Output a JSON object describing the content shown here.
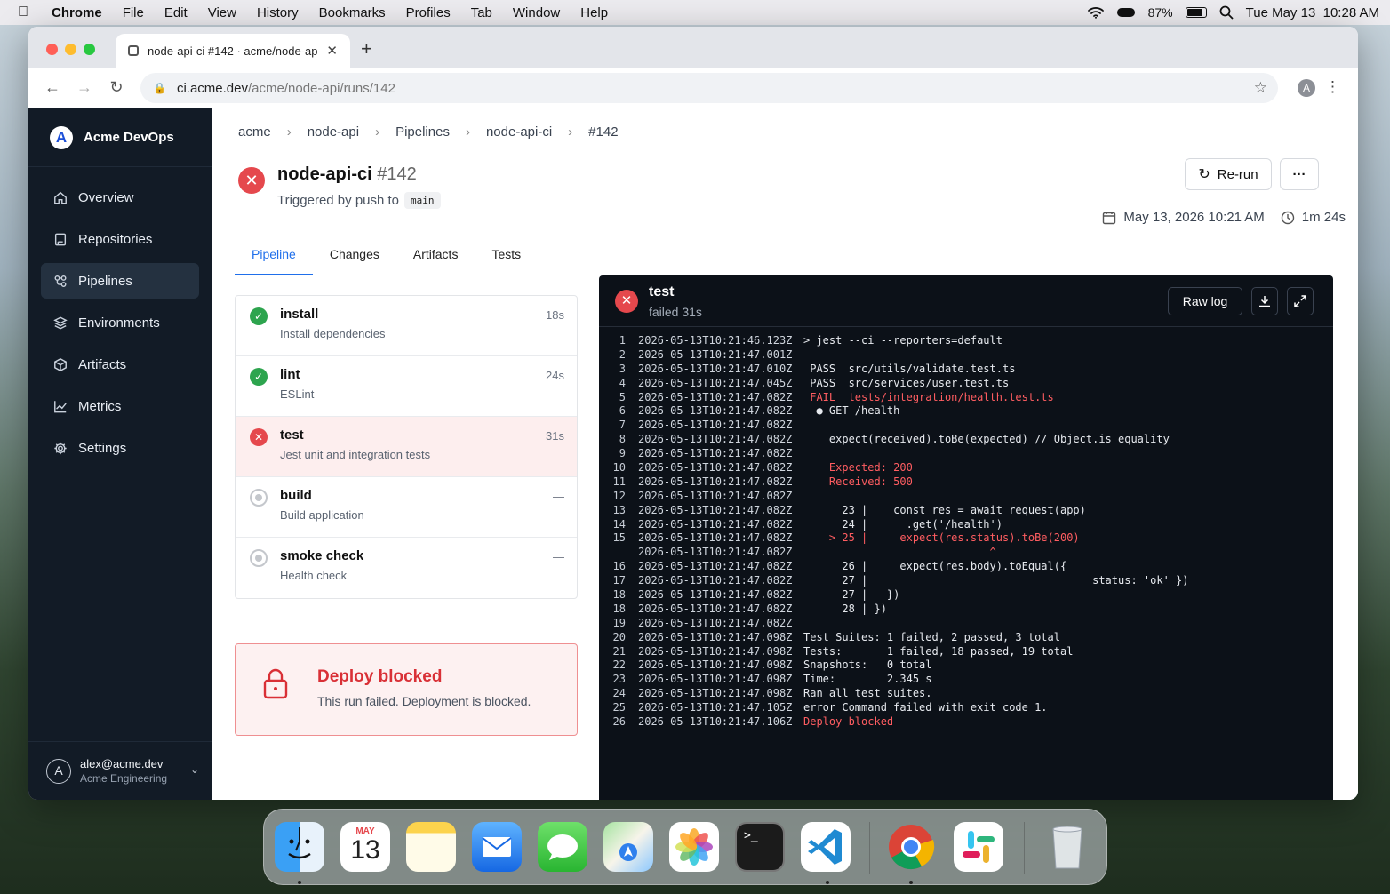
{
  "menubar": {
    "app": "Chrome",
    "items": [
      "File",
      "Edit",
      "View",
      "History",
      "Bookmarks",
      "Profiles",
      "Tab",
      "Window",
      "Help"
    ],
    "battery": "87%",
    "datetime": "Tue May 13  10:28 AM"
  },
  "browser": {
    "tab_title": "node-api-ci #142 · acme/node-ap",
    "url_host": "ci.acme.dev",
    "url_path": "/acme/node-api/runs/142",
    "profile_initial": "A"
  },
  "sidebar": {
    "brand": "Acme DevOps",
    "brand_initial": "A",
    "items": [
      {
        "label": "Overview",
        "icon": "home-icon"
      },
      {
        "label": "Repositories",
        "icon": "book-icon"
      },
      {
        "label": "Pipelines",
        "icon": "pipeline-icon",
        "active": true
      },
      {
        "label": "Environments",
        "icon": "layers-icon"
      },
      {
        "label": "Artifacts",
        "icon": "box-icon"
      },
      {
        "label": "Metrics",
        "icon": "chart-icon"
      },
      {
        "label": "Settings",
        "icon": "gear-icon"
      }
    ],
    "user": {
      "initial": "A",
      "email": "alex@acme.dev",
      "org": "Acme Engineering"
    }
  },
  "breadcrumb": [
    "acme",
    "node-api",
    "Pipelines",
    "node-api-ci",
    "#142"
  ],
  "run": {
    "name": "node-api-ci",
    "number": "#142",
    "trigger": "Triggered by push to",
    "branch": "main",
    "rerun_label": "Re-run",
    "more_label": "···",
    "date": "May 13, 2026 10:21 AM",
    "duration": "1m 24s"
  },
  "tabs": [
    "Pipeline",
    "Changes",
    "Artifacts",
    "Tests"
  ],
  "steps": [
    {
      "name": "install",
      "desc": "Install dependencies",
      "duration": "18s",
      "status": "success"
    },
    {
      "name": "lint",
      "desc": "ESLint",
      "duration": "24s",
      "status": "success"
    },
    {
      "name": "test",
      "desc": "Jest unit and integration tests",
      "duration": "31s",
      "status": "failed"
    },
    {
      "name": "build",
      "desc": "Build application",
      "duration": "—",
      "status": "pending"
    },
    {
      "name": "smoke check",
      "desc": "Health check",
      "duration": "—",
      "status": "pending"
    }
  ],
  "deploy": {
    "title": "Deploy blocked",
    "message": "This run failed. Deployment is blocked."
  },
  "log": {
    "step": "test",
    "status": "failed 31s",
    "raw_label": "Raw log",
    "lines": [
      {
        "n": "1",
        "ts": "2026-05-13T10:21:46.123Z",
        "text": "> jest --ci --reporters=default"
      },
      {
        "n": "2",
        "ts": "2026-05-13T10:21:47.001Z",
        "text": ""
      },
      {
        "n": "3",
        "ts": "2026-05-13T10:21:47.010Z",
        "text": " PASS  src/utils/validate.test.ts"
      },
      {
        "n": "4",
        "ts": "2026-05-13T10:21:47.045Z",
        "text": " PASS  src/services/user.test.ts"
      },
      {
        "n": "5",
        "ts": "2026-05-13T10:21:47.082Z",
        "text": " FAIL  tests/integration/health.test.ts",
        "red": true
      },
      {
        "n": "6",
        "ts": "2026-05-13T10:21:47.082Z",
        "text": "  ● GET /health"
      },
      {
        "n": "7",
        "ts": "2026-05-13T10:21:47.082Z",
        "text": ""
      },
      {
        "n": "8",
        "ts": "2026-05-13T10:21:47.082Z",
        "text": "    expect(received).toBe(expected) // Object.is equality"
      },
      {
        "n": "9",
        "ts": "2026-05-13T10:21:47.082Z",
        "text": ""
      },
      {
        "n": "10",
        "ts": "2026-05-13T10:21:47.082Z",
        "text": "    Expected: 200",
        "red": true
      },
      {
        "n": "11",
        "ts": "2026-05-13T10:21:47.082Z",
        "text": "    Received: 500",
        "red": true
      },
      {
        "n": "12",
        "ts": "2026-05-13T10:21:47.082Z",
        "text": ""
      },
      {
        "n": "13",
        "ts": "2026-05-13T10:21:47.082Z",
        "text": "      23 |    const res = await request(app)"
      },
      {
        "n": "14",
        "ts": "2026-05-13T10:21:47.082Z",
        "text": "      24 |      .get('/health')"
      },
      {
        "n": "15",
        "ts": "2026-05-13T10:21:47.082Z",
        "text": "    > 25 |     expect(res.status).toBe(200)",
        "red": true
      },
      {
        "n": "",
        "ts": "2026-05-13T10:21:47.082Z",
        "text": "                             ^",
        "red": true
      },
      {
        "n": "16",
        "ts": "2026-05-13T10:21:47.082Z",
        "text": "      26 |     expect(res.body).toEqual({"
      },
      {
        "n": "17",
        "ts": "2026-05-13T10:21:47.082Z",
        "text": "      27 |                                   status: 'ok' })"
      },
      {
        "n": "18",
        "ts": "2026-05-13T10:21:47.082Z",
        "text": "      27 |   })"
      },
      {
        "n": "18",
        "ts": "2026-05-13T10:21:47.082Z",
        "text": "      28 | })"
      },
      {
        "n": "19",
        "ts": "2026-05-13T10:21:47.082Z",
        "text": ""
      },
      {
        "n": "20",
        "ts": "2026-05-13T10:21:47.098Z",
        "text": "Test Suites: 1 failed, 2 passed, 3 total"
      },
      {
        "n": "21",
        "ts": "2026-05-13T10:21:47.098Z",
        "text": "Tests:       1 failed, 18 passed, 19 total"
      },
      {
        "n": "22",
        "ts": "2026-05-13T10:21:47.098Z",
        "text": "Snapshots:   0 total"
      },
      {
        "n": "23",
        "ts": "2026-05-13T10:21:47.098Z",
        "text": "Time:        2.345 s"
      },
      {
        "n": "24",
        "ts": "2026-05-13T10:21:47.098Z",
        "text": "Ran all test suites."
      },
      {
        "n": "25",
        "ts": "2026-05-13T10:21:47.105Z",
        "text": "error Command failed with exit code 1."
      },
      {
        "n": "26",
        "ts": "2026-05-13T10:21:47.106Z",
        "text": "Deploy blocked",
        "red": true
      }
    ]
  },
  "dock": {
    "calendar_month": "MAY",
    "calendar_day": "13",
    "apps": [
      "finder-icon",
      "calendar-icon",
      "notes-icon",
      "mail-icon",
      "messages-icon",
      "maps-icon",
      "photos-icon",
      "terminal-icon",
      "vscode-icon",
      "chrome-icon",
      "slack-icon",
      "trash-icon"
    ]
  },
  "colors": {
    "accent": "#1f6feb",
    "error": "#e5484d",
    "success": "#2da44e",
    "sidebar": "#121b26",
    "terminal": "#0c1118"
  }
}
